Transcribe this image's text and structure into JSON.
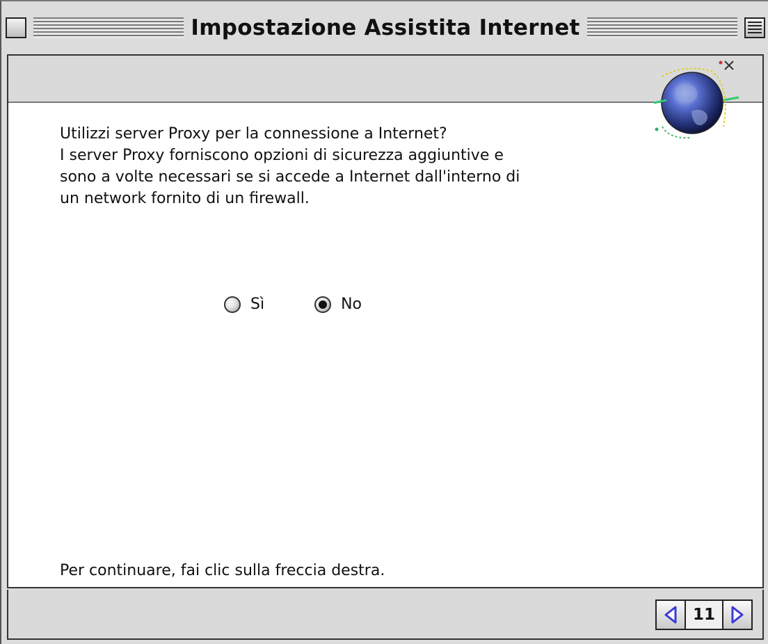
{
  "window": {
    "title": "Impostazione Assistita Internet"
  },
  "content": {
    "lines": [
      "Utilizzi server Proxy per la connessione a Internet?",
      "I server Proxy forniscono opzioni di sicurezza aggiuntive e",
      "sono a volte necessari se si accede a Internet dall'interno di",
      "un network fornito di un firewall."
    ],
    "radio_options": [
      {
        "label": "Sì",
        "selected": false
      },
      {
        "label": "No",
        "selected": true
      }
    ],
    "footer_instruction": "Per continuare, fai clic sulla freccia destra."
  },
  "navigation": {
    "page_number": "11",
    "prev_icon": "left-arrow-icon",
    "next_icon": "right-arrow-icon",
    "arrow_color": "#3a3ad8"
  },
  "icons": {
    "globe": "globe-icon"
  }
}
